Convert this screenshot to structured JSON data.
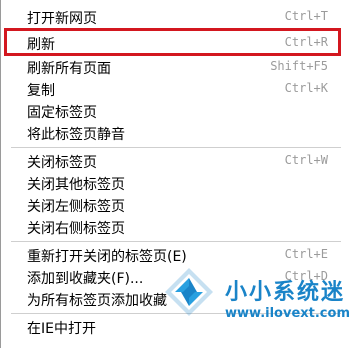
{
  "menu": {
    "items": [
      {
        "label": "打开新网页",
        "shortcut": "Ctrl+T"
      },
      {
        "label": "刷新",
        "shortcut": "Ctrl+R"
      },
      {
        "label": "刷新所有页面",
        "shortcut": "Shift+F5"
      },
      {
        "label": "复制",
        "shortcut": "Ctrl+K"
      },
      {
        "label": "固定标签页",
        "shortcut": ""
      },
      {
        "label": "将此标签页静音",
        "shortcut": ""
      },
      {
        "label": "关闭标签页",
        "shortcut": "Ctrl+W"
      },
      {
        "label": "关闭其他标签页",
        "shortcut": ""
      },
      {
        "label": "关闭左侧标签页",
        "shortcut": ""
      },
      {
        "label": "关闭右侧标签页",
        "shortcut": ""
      },
      {
        "label": "重新打开关闭的标签页(E)",
        "shortcut": "Ctrl+E"
      },
      {
        "label": "添加到收藏夹(F)...",
        "shortcut": "Ctrl+D"
      },
      {
        "label": "为所有标签页添加收藏",
        "shortcut": ""
      },
      {
        "label": "在IE中打开",
        "shortcut": ""
      }
    ]
  },
  "highlight": {
    "color": "#d3171f"
  },
  "watermark": {
    "title": "小小系统迷",
    "url": "www.ilovext.com",
    "color": "#1a84c8"
  }
}
